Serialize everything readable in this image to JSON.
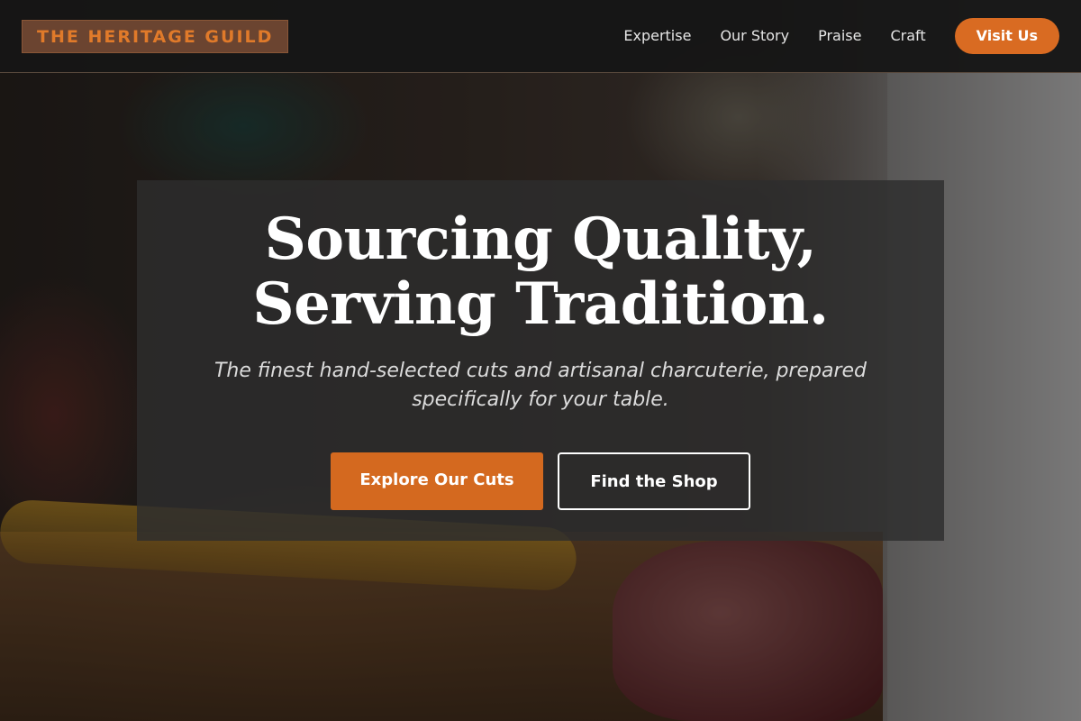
{
  "header": {
    "logo_text": "THE HERITAGE GUILD",
    "nav": [
      {
        "label": "Expertise"
      },
      {
        "label": "Our Story"
      },
      {
        "label": "Praise"
      },
      {
        "label": "Craft"
      }
    ],
    "cta_label": "Visit Us"
  },
  "hero": {
    "title_line1": "Sourcing Quality,",
    "title_line2": "Serving Tradition.",
    "subtitle": "The finest hand-selected cuts and artisanal charcuterie, prepared specifically for your table.",
    "primary_button": "Explore Our Cuts",
    "secondary_button": "Find the Shop"
  },
  "colors": {
    "accent": "#d96b22",
    "header_bg": "#161616",
    "card_bg": "#2d2d2d",
    "logo_bg": "#6b4430"
  }
}
